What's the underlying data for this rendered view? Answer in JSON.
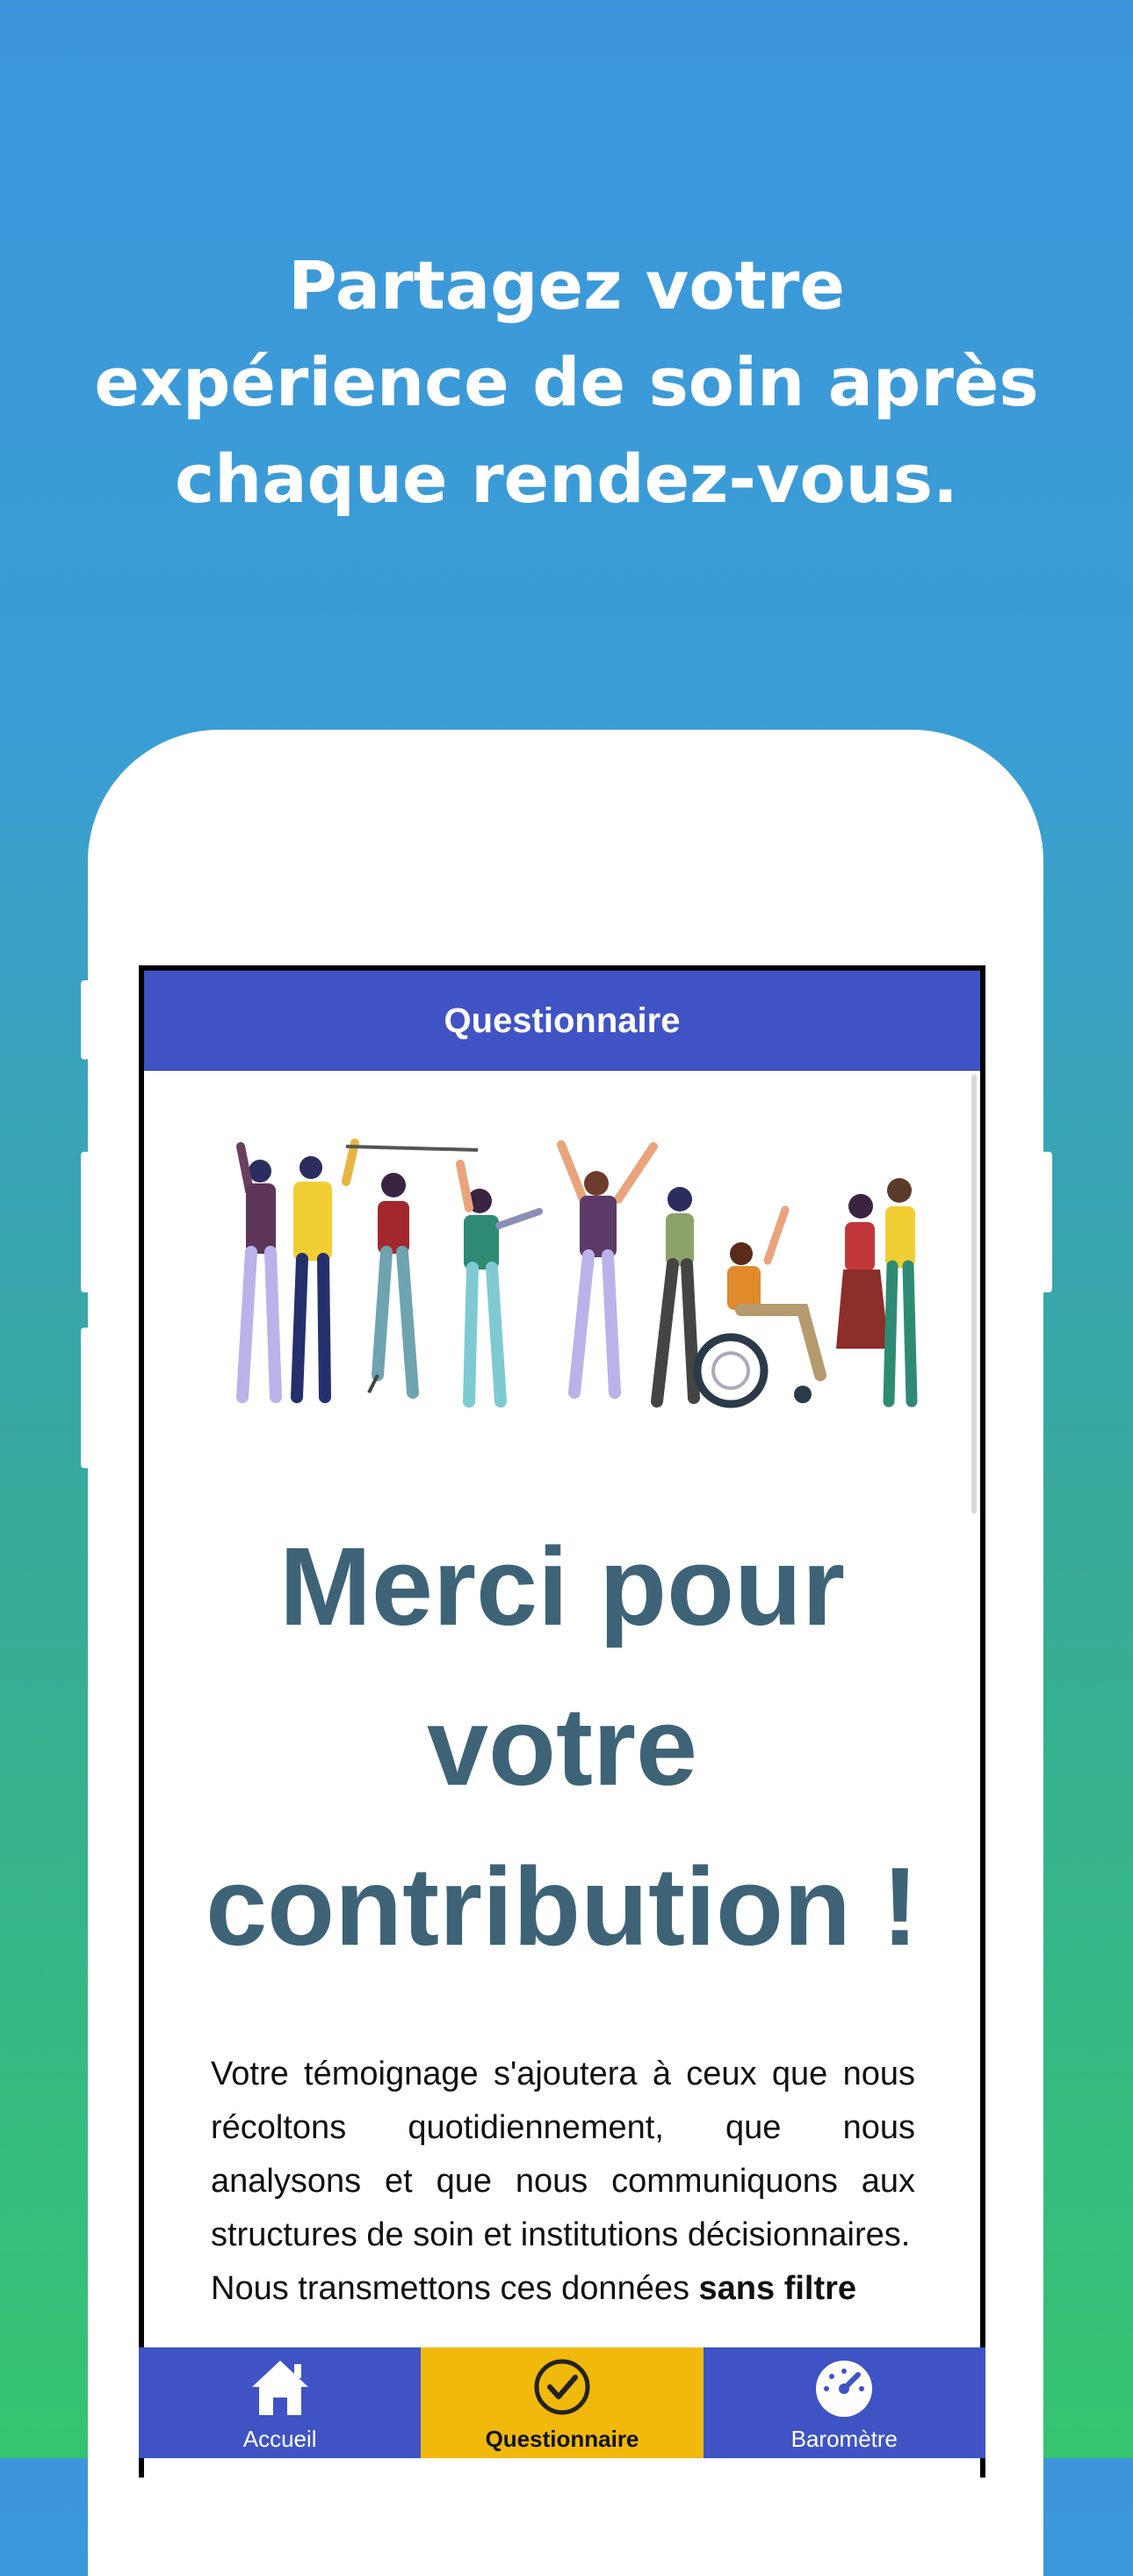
{
  "headline": {
    "line1": "Partagez votre",
    "line2": "expérience de soin après",
    "line3": "chaque rendez-vous."
  },
  "app": {
    "header_title": "Questionnaire",
    "thanks": {
      "line1": "Merci pour",
      "line2": "votre",
      "line3": "contribution !"
    },
    "body": {
      "paragraph1": "Votre témoignage s'ajoutera à ceux que nous récoltons quotidiennement, que nous analysons et que nous communiquons aux structures de soin et institutions décisionnaires.",
      "paragraph2_start": "Nous transmettons ces données ",
      "paragraph2_bold": "sans filtre"
    },
    "tabs": [
      {
        "label": "Accueil",
        "icon": "home-icon"
      },
      {
        "label": "Questionnaire",
        "icon": "check-circle-icon"
      },
      {
        "label": "Baromètre",
        "icon": "gauge-icon"
      }
    ]
  },
  "colors": {
    "header_blue": "#3f53c4",
    "active_tab": "#f0b90b",
    "thanks_text": "#3e6377",
    "gradient_top": "#3d96dc",
    "gradient_bottom": "#36c470"
  }
}
